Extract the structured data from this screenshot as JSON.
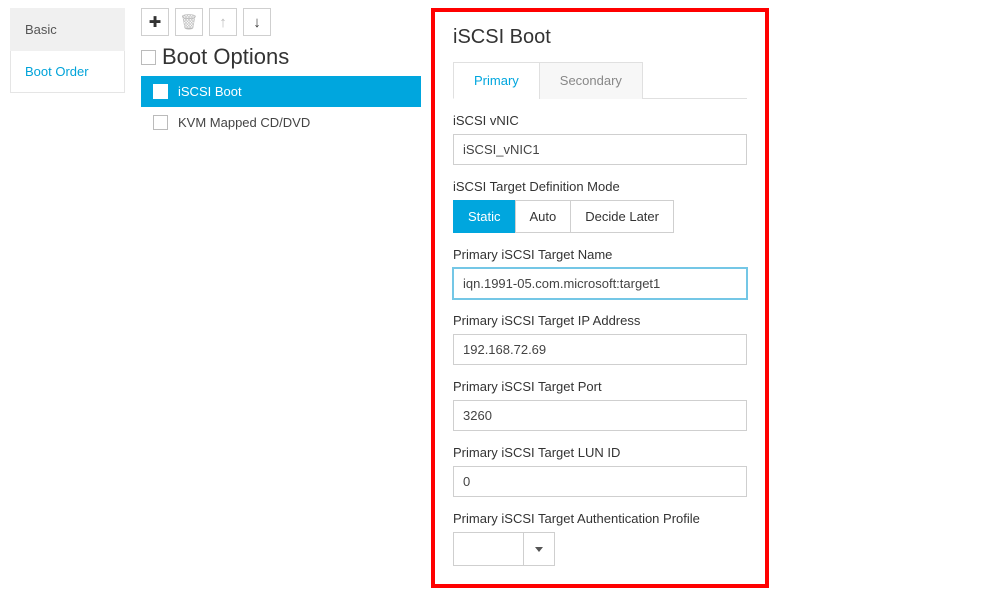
{
  "sidebar": {
    "basic": "Basic",
    "bootorder": "Boot Order"
  },
  "middle": {
    "section": "Boot Options",
    "items": [
      {
        "label": "iSCSI Boot",
        "selected": true
      },
      {
        "label": "KVM Mapped CD/DVD",
        "selected": false
      }
    ]
  },
  "panel": {
    "title": "iSCSI Boot",
    "tabs": {
      "primary": "Primary",
      "secondary": "Secondary"
    },
    "vnic": {
      "label": "iSCSI vNIC",
      "value": "iSCSI_vNIC1"
    },
    "mode": {
      "label": "iSCSI Target Definition Mode",
      "options": {
        "static": "Static",
        "auto": "Auto",
        "later": "Decide Later"
      }
    },
    "tname": {
      "label": "Primary iSCSI Target Name",
      "value": "iqn.1991-05.com.microsoft:target1"
    },
    "tip": {
      "label": "Primary iSCSI Target IP Address",
      "value": "192.168.72.69"
    },
    "tport": {
      "label": "Primary iSCSI Target Port",
      "value": "3260"
    },
    "tlun": {
      "label": "Primary iSCSI Target LUN ID",
      "value": "0"
    },
    "tauth": {
      "label": "Primary iSCSI Target Authentication Profile",
      "value": ""
    }
  }
}
